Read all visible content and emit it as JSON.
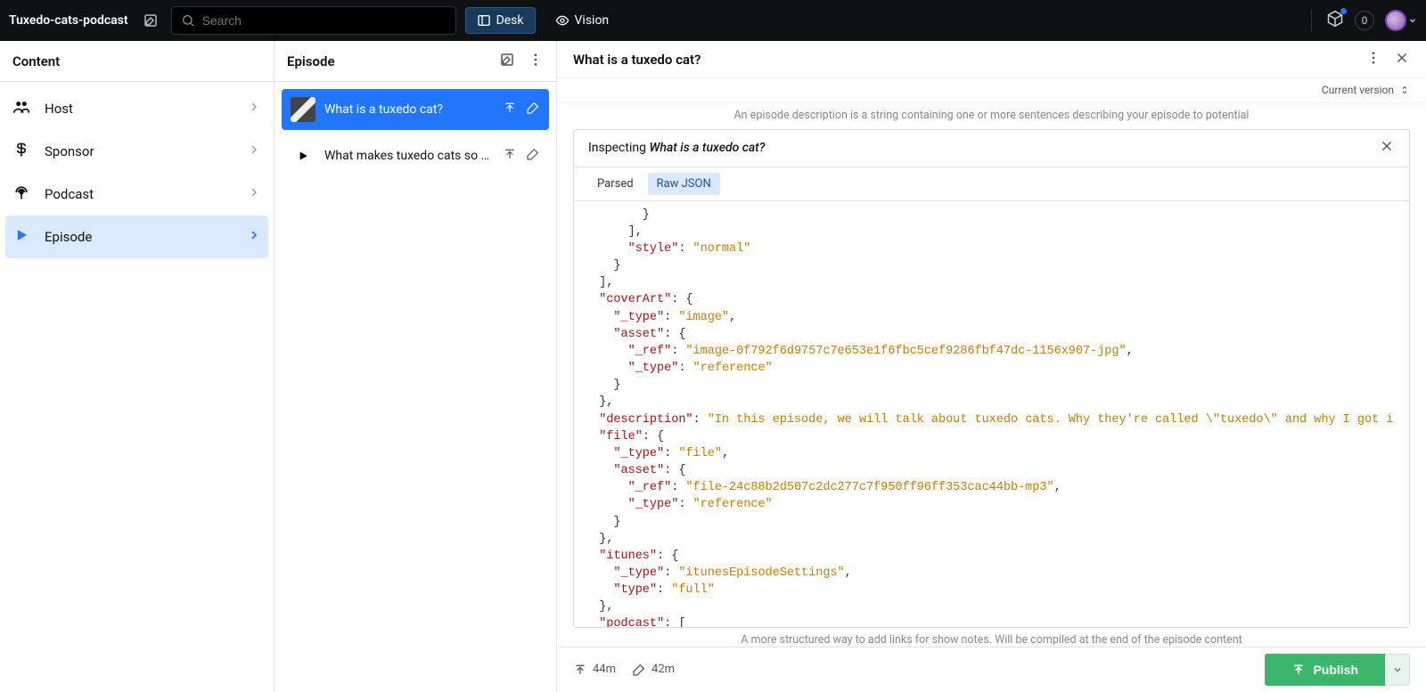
{
  "topbar": {
    "app_title": "Tuxedo-cats-podcast",
    "search_placeholder": "Search",
    "nav_desk": "Desk",
    "nav_vision": "Vision",
    "notif_count": "0"
  },
  "panel1": {
    "title": "Content",
    "items": [
      {
        "label": "Host",
        "icon": "users-icon"
      },
      {
        "label": "Sponsor",
        "icon": "dollar-icon"
      },
      {
        "label": "Podcast",
        "icon": "podcast-icon"
      },
      {
        "label": "Episode",
        "icon": "play-icon"
      }
    ]
  },
  "panel2": {
    "title": "Episode",
    "items": [
      {
        "label": "What is a tuxedo cat?",
        "selected": true
      },
      {
        "label": "What makes tuxedo cats so c…",
        "selected": false
      }
    ]
  },
  "detail": {
    "title": "What is a tuxedo cat?",
    "version_label": "Current version",
    "hint_top": "An episode description is a string containing one or more sentences describing your episode to potential",
    "hint_bottom": "A more structured way to add links for show notes. Will be compiled at the end of the episode content",
    "inspect_prefix": "Inspecting",
    "inspect_target": "What is a tuxedo cat?",
    "tabs": {
      "parsed": "Parsed",
      "raw": "Raw JSON"
    },
    "json_lines": [
      [
        [
          "p",
          "        }"
        ]
      ],
      [
        [
          "p",
          "      ],"
        ]
      ],
      [
        [
          "p",
          "      "
        ],
        [
          "k",
          "\"style\""
        ],
        [
          "p",
          ": "
        ],
        [
          "s",
          "\"normal\""
        ]
      ],
      [
        [
          "p",
          "    }"
        ]
      ],
      [
        [
          "p",
          "  ],"
        ]
      ],
      [
        [
          "p",
          "  "
        ],
        [
          "k",
          "\"coverArt\""
        ],
        [
          "p",
          ": {"
        ]
      ],
      [
        [
          "p",
          "    "
        ],
        [
          "k",
          "\"_type\""
        ],
        [
          "p",
          ": "
        ],
        [
          "s",
          "\"image\""
        ],
        [
          "p",
          ","
        ]
      ],
      [
        [
          "p",
          "    "
        ],
        [
          "k",
          "\"asset\""
        ],
        [
          "p",
          ": {"
        ]
      ],
      [
        [
          "p",
          "      "
        ],
        [
          "k",
          "\"_ref\""
        ],
        [
          "p",
          ": "
        ],
        [
          "s",
          "\"image-0f792f6d9757c7e653e1f6fbc5cef9286fbf47dc-1156x907-jpg\""
        ],
        [
          "p",
          ","
        ]
      ],
      [
        [
          "p",
          "      "
        ],
        [
          "k",
          "\"_type\""
        ],
        [
          "p",
          ": "
        ],
        [
          "s",
          "\"reference\""
        ]
      ],
      [
        [
          "p",
          "    }"
        ]
      ],
      [
        [
          "p",
          "  },"
        ]
      ],
      [
        [
          "p",
          "  "
        ],
        [
          "k",
          "\"description\""
        ],
        [
          "p",
          ": "
        ],
        [
          "s",
          "\"In this episode, we will talk about tuxedo cats. Why they're called \\\"tuxedo\\\" and why I got i"
        ]
      ],
      [
        [
          "p",
          "  "
        ],
        [
          "k",
          "\"file\""
        ],
        [
          "p",
          ": {"
        ]
      ],
      [
        [
          "p",
          "    "
        ],
        [
          "k",
          "\"_type\""
        ],
        [
          "p",
          ": "
        ],
        [
          "s",
          "\"file\""
        ],
        [
          "p",
          ","
        ]
      ],
      [
        [
          "p",
          "    "
        ],
        [
          "k",
          "\"asset\""
        ],
        [
          "p",
          ": {"
        ]
      ],
      [
        [
          "p",
          "      "
        ],
        [
          "k",
          "\"_ref\""
        ],
        [
          "p",
          ": "
        ],
        [
          "s",
          "\"file-24c88b2d507c2dc277c7f950ff96ff353cac44bb-mp3\""
        ],
        [
          "p",
          ","
        ]
      ],
      [
        [
          "p",
          "      "
        ],
        [
          "k",
          "\"_type\""
        ],
        [
          "p",
          ": "
        ],
        [
          "s",
          "\"reference\""
        ]
      ],
      [
        [
          "p",
          "    }"
        ]
      ],
      [
        [
          "p",
          "  },"
        ]
      ],
      [
        [
          "p",
          "  "
        ],
        [
          "k",
          "\"itunes\""
        ],
        [
          "p",
          ": {"
        ]
      ],
      [
        [
          "p",
          "    "
        ],
        [
          "k",
          "\"_type\""
        ],
        [
          "p",
          ": "
        ],
        [
          "s",
          "\"itunesEpisodeSettings\""
        ],
        [
          "p",
          ","
        ]
      ],
      [
        [
          "p",
          "    "
        ],
        [
          "k",
          "\"type\""
        ],
        [
          "p",
          ": "
        ],
        [
          "s",
          "\"full\""
        ]
      ],
      [
        [
          "p",
          "  },"
        ]
      ],
      [
        [
          "p",
          "  "
        ],
        [
          "k",
          "\"podcast\""
        ],
        [
          "p",
          ": ["
        ]
      ]
    ]
  },
  "footer": {
    "published_ago": "44m",
    "edited_ago": "42m",
    "publish_label": "Publish"
  }
}
